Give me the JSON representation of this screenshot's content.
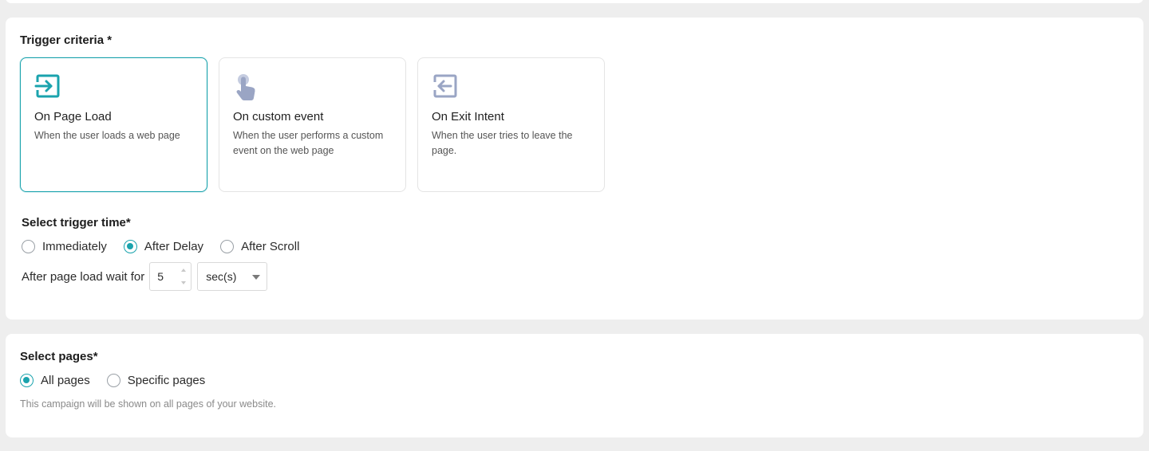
{
  "trigger": {
    "title": "Trigger criteria *",
    "cards": [
      {
        "icon": "page-enter-icon",
        "title": "On Page Load",
        "description": "When the user loads a web page",
        "selected": true
      },
      {
        "icon": "tap-hand-icon",
        "title": "On custom event",
        "description": "When the user performs a custom event on the web page",
        "selected": false
      },
      {
        "icon": "exit-intent-icon",
        "title": "On Exit Intent",
        "description": "When the user tries to leave the page.",
        "selected": false
      }
    ],
    "time_title": "Select trigger time*",
    "time_options": [
      {
        "label": "Immediately",
        "checked": false
      },
      {
        "label": "After Delay",
        "checked": true
      },
      {
        "label": "After Scroll",
        "checked": false
      }
    ],
    "wait_label": "After page load wait for",
    "wait_value": "5",
    "wait_unit": "sec(s)"
  },
  "pages": {
    "title": "Select pages*",
    "options": [
      {
        "label": "All pages",
        "checked": true
      },
      {
        "label": "Specific pages",
        "checked": false
      }
    ],
    "note": "This campaign will be shown on all pages of your website."
  },
  "colors": {
    "accent": "#1aa3ad",
    "icon_muted": "#9aa5c4",
    "background": "#eeeeee"
  }
}
